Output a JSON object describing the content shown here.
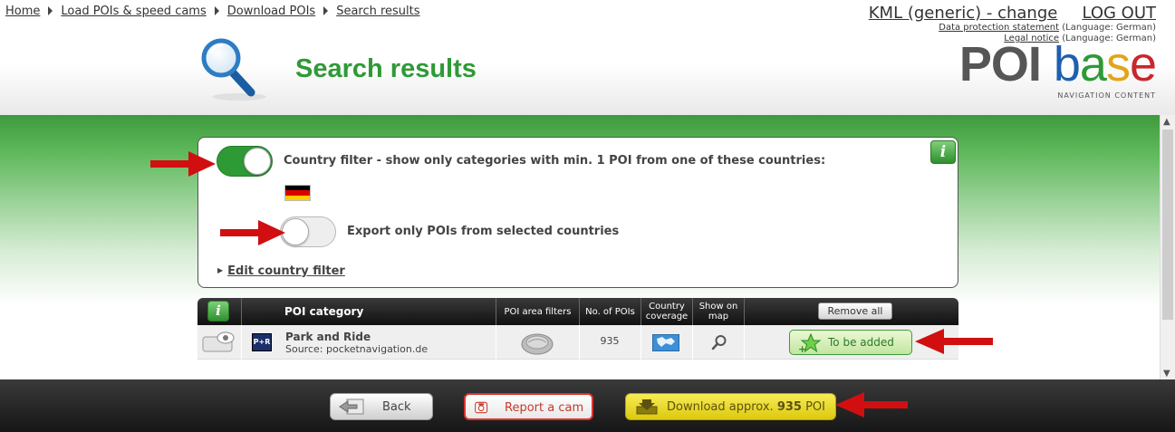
{
  "breadcrumb": [
    "Home",
    "Load POIs & speed cams",
    "Download POIs",
    "Search results"
  ],
  "header": {
    "kml_link": "KML (generic) - change",
    "logout": "LOG OUT",
    "data_protection": "Data protection statement",
    "data_protection_lang": "(Language: German)",
    "legal_notice": "Legal notice",
    "legal_notice_lang": "(Language: German)",
    "title": "Search results",
    "logo_poi": "POI",
    "logo_b": "b",
    "logo_a": "a",
    "logo_s": "s",
    "logo_e": "e",
    "logo_sub": "NAVIGATION CONTENT"
  },
  "filter": {
    "country_filter_label": "Country filter - show only categories with min. 1 POI from one of these countries:",
    "country_filter_on": true,
    "countries": [
      "Germany"
    ],
    "export_only_label": "Export only POIs from selected countries",
    "export_only_on": false,
    "edit_link": "Edit country filter",
    "info_icon": "i"
  },
  "table": {
    "headers": {
      "info_icon": "i",
      "category": "POI category",
      "area_filters": "POI area filters",
      "num_pois": "No. of POIs",
      "coverage": "Country coverage",
      "show_map": "Show on map",
      "remove_all": "Remove all"
    },
    "rows": [
      {
        "icon_label": "P+R",
        "name": "Park and Ride",
        "source": "Source: pocketnavigation.de",
        "count": "935",
        "action": "To be added"
      }
    ]
  },
  "footer": {
    "back": "Back",
    "report": "Report a cam",
    "download_prefix": "Download approx.",
    "download_count": "935",
    "download_suffix": "POI"
  },
  "colors": {
    "title_green": "#2e9a36",
    "annotation_red": "#d10f10",
    "download_yellow": "#f0de2a"
  }
}
